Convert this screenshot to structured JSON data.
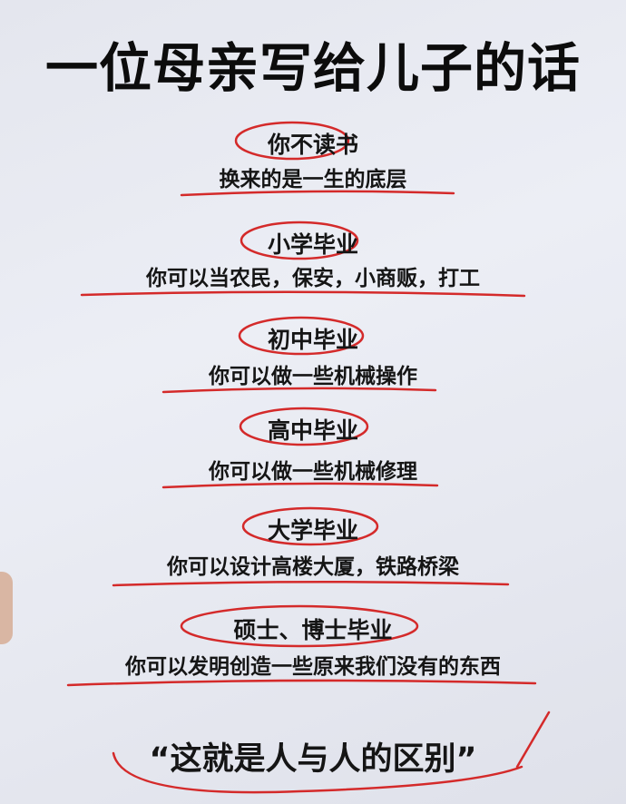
{
  "title": "一位母亲写给儿子的话",
  "sections": [
    {
      "heading": "你不读书",
      "text": "换来的是一生的底层"
    },
    {
      "heading": "小学毕业",
      "text": "你可以当农民，保安，小商贩，打工"
    },
    {
      "heading": "初中毕业",
      "text": "你可以做一些机械操作"
    },
    {
      "heading": "高中毕业",
      "text": "你可以做一些机械修理"
    },
    {
      "heading": "大学毕业",
      "text": "你可以设计高楼大厦，铁路桥梁"
    },
    {
      "heading": "硕士、博士毕业",
      "text": "你可以发明创造一些原来我们没有的东西"
    }
  ],
  "quote": "“这就是人与人的区别”",
  "colors": {
    "ink": "#151515",
    "marker": "#d42a2a",
    "paper": "#e8eaf2"
  }
}
